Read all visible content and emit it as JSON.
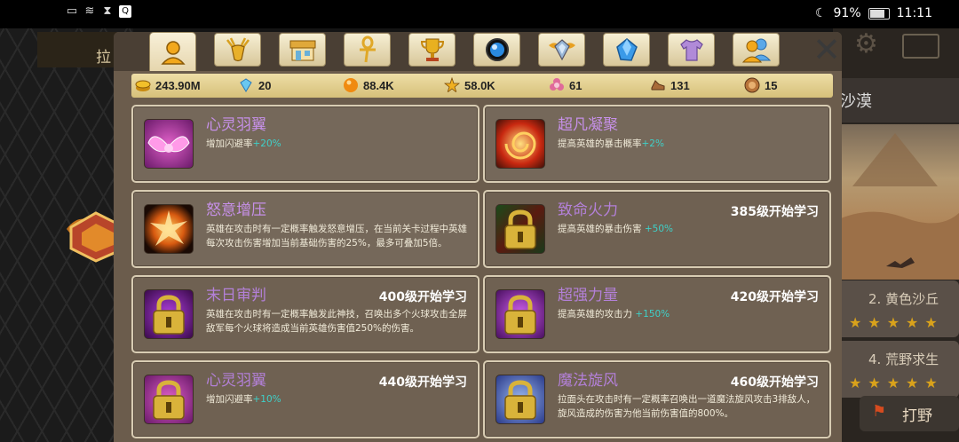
{
  "status_bar": {
    "battery": "91%",
    "time": "11:11"
  },
  "background": {
    "left_label": "拉",
    "right_title": "沙漠",
    "levels": [
      {
        "label": "2. 黄色沙丘",
        "stars": "★★★★★"
      },
      {
        "label": "4. 荒野求生",
        "stars": "★★★★★"
      }
    ],
    "fight_label": "打野"
  },
  "tabs": [
    {
      "name": "hero-tab",
      "icon": "person-icon",
      "active": true
    },
    {
      "name": "deer-tab",
      "icon": "deer-head-icon",
      "active": false
    },
    {
      "name": "shop-tab",
      "icon": "shop-icon",
      "active": false
    },
    {
      "name": "ankh-tab",
      "icon": "ankh-icon",
      "active": false
    },
    {
      "name": "trophy-tab",
      "icon": "trophy-icon",
      "active": false
    },
    {
      "name": "orb-tab",
      "icon": "blue-orb-icon",
      "active": false
    },
    {
      "name": "gem-badge-tab",
      "icon": "winged-gem-icon",
      "active": false
    },
    {
      "name": "crystal-tab",
      "icon": "crystal-icon",
      "active": false
    },
    {
      "name": "shirt-tab",
      "icon": "shirt-icon",
      "active": false
    },
    {
      "name": "friends-tab",
      "icon": "friends-icon",
      "active": false
    }
  ],
  "currencies": [
    {
      "icon": "gold-coins-icon",
      "value": "243.90M"
    },
    {
      "icon": "diamond-icon",
      "value": "20"
    },
    {
      "icon": "orange-orb-icon",
      "value": "88.4K"
    },
    {
      "icon": "star-burst-icon",
      "value": "58.0K"
    },
    {
      "icon": "pink-flower-icon",
      "value": "61"
    },
    {
      "icon": "brown-shoe-icon",
      "value": "131"
    },
    {
      "icon": "bronze-coin-icon",
      "value": "15"
    }
  ],
  "skills": [
    {
      "name": "心灵羽翼",
      "desc": "增加闪避率",
      "bonus": "+20%",
      "unlock": "",
      "locked": false,
      "icon": "pink-wings-icon"
    },
    {
      "name": "超凡凝聚",
      "desc": "提高英雄的暴击概率",
      "bonus": "+2%",
      "unlock": "",
      "locked": false,
      "icon": "fire-swirl-icon"
    },
    {
      "name": "怒意增压",
      "desc": "英雄在攻击时有一定概率触发怒意增压，在当前关卡过程中英雄每次攻击伤害增加当前基础伤害的25%，最多可叠加5倍。",
      "bonus": "",
      "unlock": "",
      "locked": false,
      "icon": "rage-burst-icon"
    },
    {
      "name": "致命火力",
      "desc": "提高英雄的暴击伤害",
      "bonus": "+50%",
      "unlock": "385级开始学习",
      "locked": true,
      "icon": "lock-icon"
    },
    {
      "name": "末日审判",
      "desc": "英雄在攻击时有一定概率触发此神技，召唤出多个火球攻击全屏敌军每个火球将造成当前英雄伤害值250%的伤害。",
      "bonus": "",
      "unlock": "400级开始学习",
      "locked": true,
      "icon": "lock-icon"
    },
    {
      "name": "超强力量",
      "desc": "提高英雄的攻击力",
      "bonus": "+150%",
      "unlock": "420级开始学习",
      "locked": true,
      "icon": "lock-icon"
    },
    {
      "name": "心灵羽翼",
      "desc": "增加闪避率",
      "bonus": "+10%",
      "unlock": "440级开始学习",
      "locked": true,
      "icon": "lock-icon"
    },
    {
      "name": "魔法旋风",
      "desc": "拉面头在攻击时有一定概率召唤出一道魔法旋风攻击3排敌人，旋风造成的伤害为他当前伤害值的800%。",
      "bonus": "",
      "unlock": "460级开始学习",
      "locked": true,
      "icon": "lock-icon"
    }
  ],
  "colors": {
    "panel": "#6b5c4c",
    "skill_name": "#c690e8",
    "bonus": "#3fd0c8",
    "lock_gold": "#d9b33a"
  }
}
